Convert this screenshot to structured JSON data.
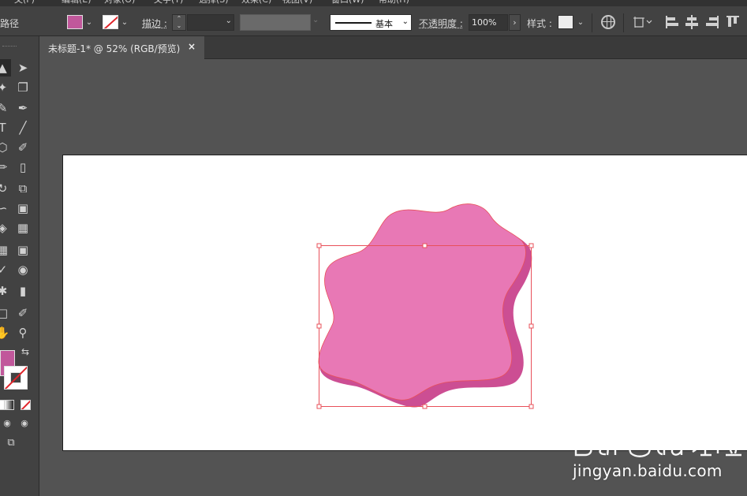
{
  "menubar": {
    "fragments": [
      "文(F)",
      "编辑(E)",
      "对象(O)",
      "文字(T)",
      "选择(S)",
      "效果(C)",
      "视图(V)",
      "窗口(W)",
      "帮助(H)"
    ]
  },
  "control_bar": {
    "selection_label": "路径",
    "fill_color": "#c1589b",
    "stroke_label": "描边 :",
    "brush_label": "基本",
    "opacity_label": "不透明度 :",
    "opacity_value": "100%",
    "style_label": "样式 :"
  },
  "document_tab": {
    "title": "未标题-1* @ 52% (RGB/预览)",
    "close_glyph": "×"
  },
  "toolbar": {
    "fill_color": "#c1589b",
    "stroke": "none"
  },
  "artwork": {
    "shape": "star-blob",
    "front_color": "#e878b5",
    "side_color": "#cc4e93",
    "selection_color": "#e8505a"
  },
  "watermark": {
    "brand": "Baidu经验",
    "url": "jingyan.baidu.com"
  }
}
